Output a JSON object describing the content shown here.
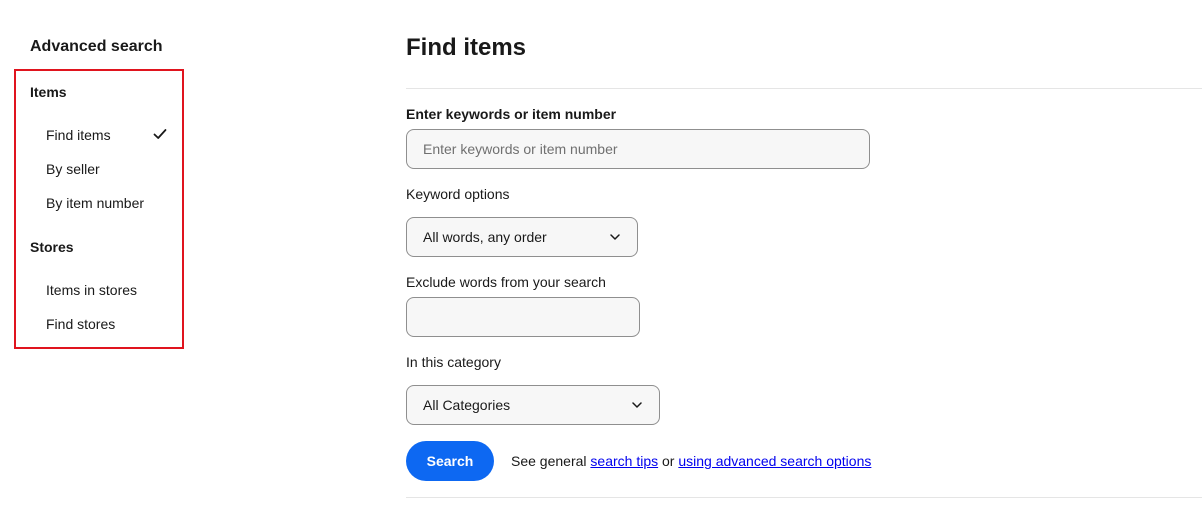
{
  "sidebar": {
    "title": "Advanced search",
    "groups": [
      {
        "heading": "Items",
        "links": [
          {
            "label": "Find items",
            "selected": true
          },
          {
            "label": "By seller",
            "selected": false
          },
          {
            "label": "By item number",
            "selected": false
          }
        ]
      },
      {
        "heading": "Stores",
        "links": [
          {
            "label": "Items in stores",
            "selected": false
          },
          {
            "label": "Find stores",
            "selected": false
          }
        ]
      }
    ],
    "highlight_color": "#e0141e"
  },
  "main": {
    "title": "Find items",
    "keywords": {
      "label": "Enter keywords or item number",
      "placeholder": "Enter keywords or item number",
      "value": ""
    },
    "keyword_options": {
      "label": "Keyword options",
      "selected": "All words, any order"
    },
    "exclude": {
      "label": "Exclude words from your search",
      "value": ""
    },
    "category": {
      "label": "In this category",
      "selected": "All Categories"
    },
    "search_button": "Search",
    "help": {
      "prefix": "See general",
      "link1": "search tips",
      "middle": "or",
      "link2": "using advanced search options"
    },
    "accent_color": "#0d68f2"
  }
}
